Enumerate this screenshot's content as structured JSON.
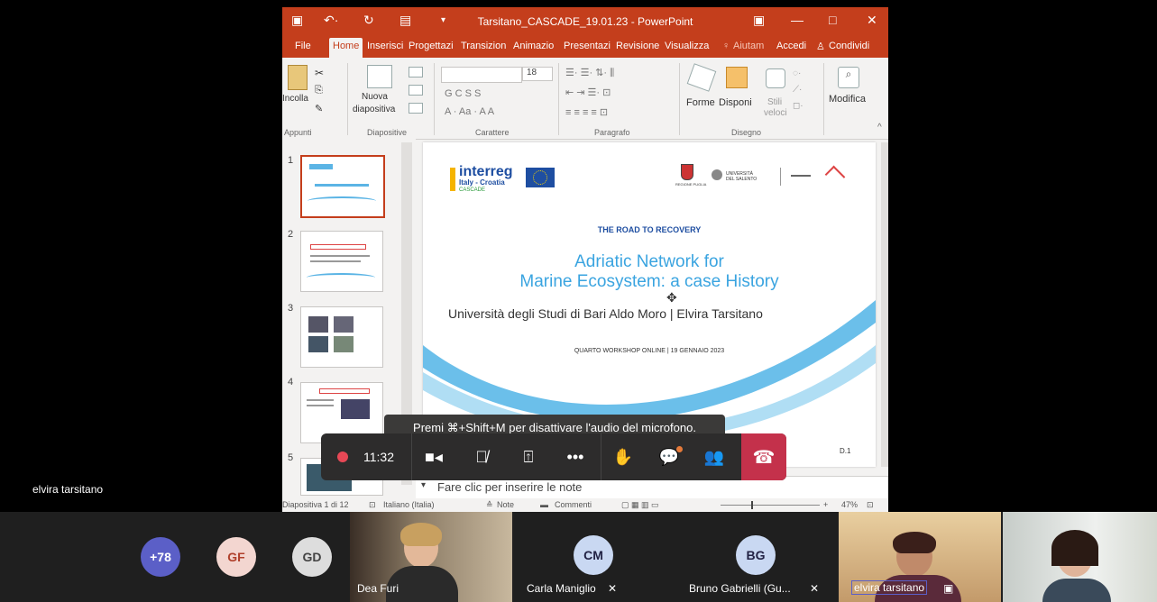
{
  "ppt": {
    "title": "Tarsitano_CASCADE_19.01.23 - PowerPoint",
    "menu": [
      "File",
      "Home",
      "Inserisci",
      "Progettazi",
      "Transizion",
      "Animazio",
      "Presentazi",
      "Revisione",
      "Visualizza"
    ],
    "help": "Aiutam",
    "signin": "Accedi",
    "share": "Condividi",
    "ribbon": {
      "paste": "Incolla",
      "new_slide_1": "Nuova",
      "new_slide_2": "diapositiva",
      "font_size": "18",
      "shapes": "Forme",
      "arrange": "Disponi",
      "quick_styles_1": "Stili",
      "quick_styles_2": "veloci",
      "edit": "Modifica",
      "groups": [
        "Appunti",
        "Diapositive",
        "Carattere",
        "Paragrafo",
        "Disegno"
      ],
      "font_letters": "G  C  S  S"
    },
    "thumbs": [
      "1",
      "2",
      "3",
      "4",
      "5"
    ],
    "slide": {
      "logo_main": "interreg",
      "logo_sub": "Italy - Croatia",
      "logo_project": "CASCADE",
      "univ_logo": "UNIVERSITÀ DEL SALENTO",
      "region_logo": "REGIONE PUGLIA",
      "kicker": "THE ROAD TO RECOVERY",
      "title_line1": "Adriatic Network for",
      "title_line2": "Marine Ecosystem: a case History",
      "author": "Università degli Studi di Bari Aldo Moro | Elvira Tarsitano",
      "event": "QUARTO WORKSHOP ONLINE | 19 GENNAIO 2023",
      "slide_code": "D.1"
    },
    "notes_placeholder": "Fare clic per inserire le note",
    "status": {
      "slide_count": "Diapositiva 1 di 12",
      "language": "Italiano (Italia)",
      "notes": "Note",
      "comments": "Commenti",
      "zoom": "47%"
    }
  },
  "meeting": {
    "tooltip": "Premi ⌘+Shift+M per disattivare l'audio del microfono.",
    "timer": "11:32",
    "speaker": "elvira tarsitano",
    "colors": {
      "leave": "#c4314b",
      "record": "#e74856",
      "bar": "#2d2c2c"
    }
  },
  "participants": {
    "overflow": "+78",
    "initials": [
      "GF",
      "GD"
    ],
    "tiles": [
      {
        "name": "Dea Furi"
      },
      {
        "initials": "CM",
        "name": "Carla Maniglio"
      },
      {
        "initials": "BG",
        "name": "Bruno Gabrielli (Gu..."
      },
      {
        "name": "elvira tarsitano"
      },
      {
        "name": ""
      }
    ]
  }
}
